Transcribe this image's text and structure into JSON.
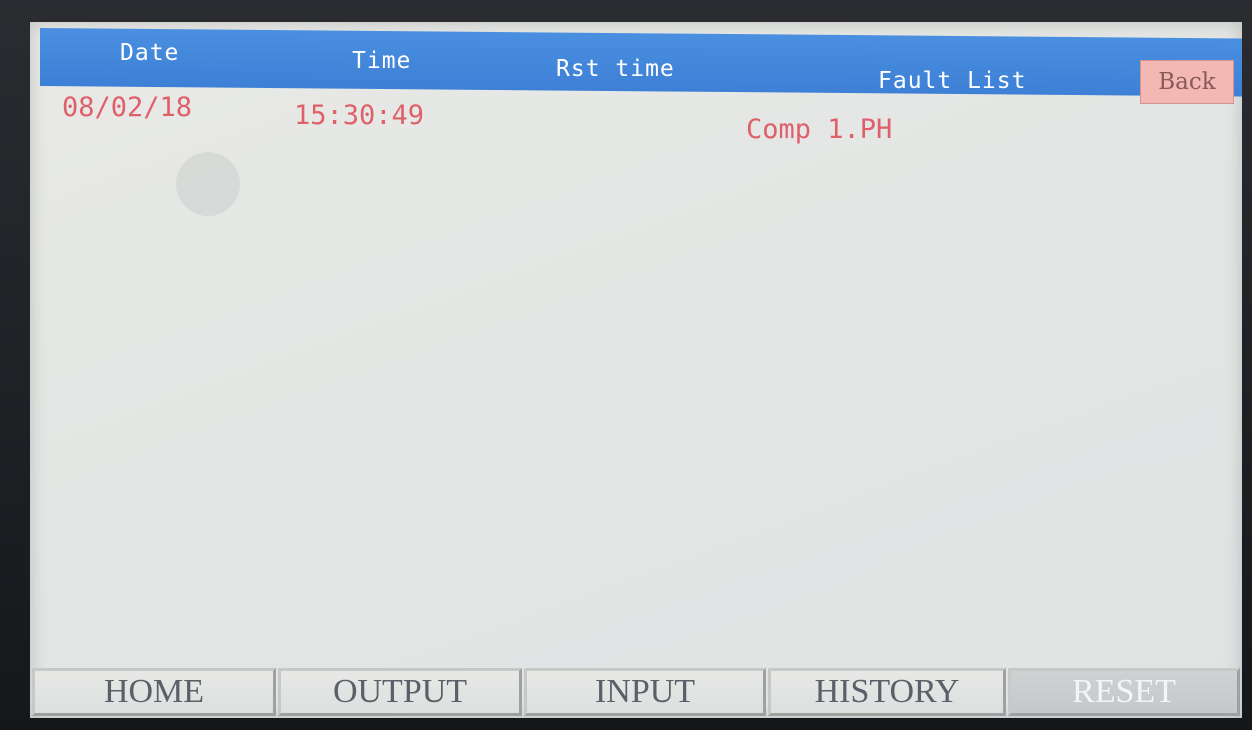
{
  "header": {
    "date_label": "Date",
    "time_label": "Time",
    "rst_time_label": "Rst time",
    "fault_list_label": "Fault List",
    "back_label": "Back"
  },
  "faults": [
    {
      "date": "08/02/18",
      "time": "15:30:49",
      "rst_time": "",
      "fault": "Comp 1.PH"
    }
  ],
  "nav": {
    "home": "HOME",
    "output": "OUTPUT",
    "input": "INPUT",
    "history": "HISTORY",
    "reset": "RESET"
  },
  "colors": {
    "header_bg": "#3d80d6",
    "fault_text": "#e0606a",
    "back_bg": "#f3b7b4",
    "nav_bg": "#dcdfde"
  }
}
